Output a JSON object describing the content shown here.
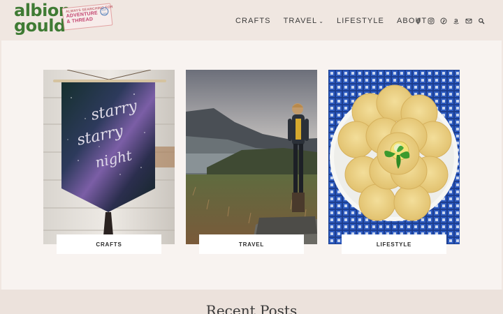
{
  "brand": {
    "name_line1": "albion",
    "name_line2": "gould",
    "tagline_1": "ALWAYS SEARCHING FOR",
    "tagline_2": "ADVENTURE",
    "tagline_3": "& THREAD",
    "stamp_est": "EST 2005",
    "color": "#3f7b34"
  },
  "nav": {
    "items": [
      {
        "label": "CRAFTS"
      },
      {
        "label": "TRAVEL",
        "has_dropdown": true
      },
      {
        "label": "LIFESTYLE"
      },
      {
        "label": "ABOUT"
      }
    ],
    "social_icons": [
      "facebook-icon",
      "instagram-icon",
      "pinterest-icon",
      "amazon-icon",
      "email-icon",
      "search-icon"
    ]
  },
  "categories": [
    {
      "label": "CRAFTS",
      "image": "starry-night-banner"
    },
    {
      "label": "TRAVEL",
      "image": "woman-on-rock-loch-view"
    },
    {
      "label": "LIFESTYLE",
      "image": "shortbread-cookies-plate"
    }
  ],
  "section": {
    "recent_title": "Recent Posts"
  },
  "colors": {
    "header_bg": "#f0e7e1",
    "content_bg": "#f8f3f0",
    "text": "#3a3a3a"
  }
}
